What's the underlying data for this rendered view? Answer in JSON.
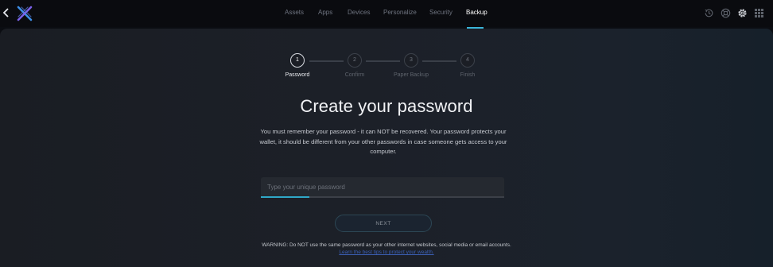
{
  "topbar": {
    "back_icon": "chevron-left-icon",
    "logo_icon": "x-logo-icon",
    "nav": [
      {
        "label": "Assets",
        "active": false
      },
      {
        "label": "Apps",
        "active": false
      },
      {
        "label": "Devices",
        "active": false
      },
      {
        "label": "Personalize",
        "active": false
      },
      {
        "label": "Security",
        "active": false
      },
      {
        "label": "Backup",
        "active": true
      }
    ],
    "right_icons": [
      "history-icon",
      "help-icon",
      "settings-gear-icon",
      "apps-grid-icon"
    ]
  },
  "stepper": {
    "steps": [
      {
        "number": "1",
        "label": "Password",
        "active": true
      },
      {
        "number": "2",
        "label": "Confirm",
        "active": false
      },
      {
        "number": "3",
        "label": "Paper Backup",
        "active": false
      },
      {
        "number": "4",
        "label": "Finish",
        "active": false
      }
    ]
  },
  "main": {
    "title": "Create your password",
    "description": "You must remember your password - it can NOT be recovered. Your password protects your wallet, it should be different from your other passwords in case someone gets access to your computer.",
    "password": {
      "value": "",
      "placeholder": "Type your unique password",
      "strength": 0.2
    },
    "next_label": "NEXT",
    "warning": "WARNING: Do NOT use the same password as your other internet websites, social media or email accounts.",
    "learn_link": "Learn the best tips to protect your wealth."
  },
  "colors": {
    "accent": "#2fa8c8",
    "logo_blue": "#3d8fe8",
    "logo_purple": "#7b61e8",
    "link": "#3b5fb5"
  }
}
